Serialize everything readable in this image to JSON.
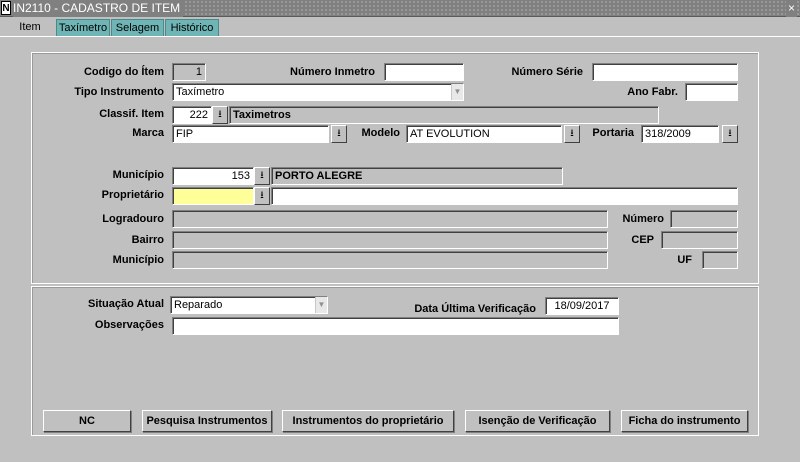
{
  "window": {
    "icon_letter": "N",
    "title": "IN2110 - CADASTRO DE ITEM",
    "close": "×"
  },
  "tabs": [
    {
      "label": "Item",
      "active": true
    },
    {
      "label": "Taxímetro",
      "active": false
    },
    {
      "label": "Selagem",
      "active": false
    },
    {
      "label": "Histórico",
      "active": false
    }
  ],
  "form": {
    "codigo_item": {
      "label": "Codigo do Ítem",
      "value": "1"
    },
    "numero_inmetro": {
      "label": "Número Inmetro",
      "value": ""
    },
    "numero_serie": {
      "label": "Número Série",
      "value": ""
    },
    "tipo_instrumento": {
      "label": "Tipo Instrumento",
      "value": "Taxímetro"
    },
    "ano_fabr": {
      "label": "Ano Fabr.",
      "value": ""
    },
    "classif_item": {
      "label": "Classif. Item",
      "code": "222",
      "description": "Taximetros"
    },
    "marca": {
      "label": "Marca",
      "value": "FIP"
    },
    "modelo": {
      "label": "Modelo",
      "value": "AT EVOLUTION"
    },
    "portaria": {
      "label": "Portaria",
      "value": "318/2009"
    },
    "municipio": {
      "label": "Município",
      "code": "153",
      "description": "PORTO ALEGRE"
    },
    "proprietario": {
      "label": "Proprietário",
      "code": "",
      "name": ""
    },
    "logradouro": {
      "label": "Logradouro",
      "value": ""
    },
    "numero": {
      "label": "Número",
      "value": ""
    },
    "bairro": {
      "label": "Bairro",
      "value": ""
    },
    "cep": {
      "label": "CEP",
      "value": ""
    },
    "municipio2": {
      "label": "Município",
      "value": ""
    },
    "uf": {
      "label": "UF",
      "value": ""
    },
    "situacao_atual": {
      "label": "Situação Atual",
      "value": "Reparado"
    },
    "data_ultima_verificacao": {
      "label": "Data Última Verificação",
      "value": "18/09/2017"
    },
    "observacoes": {
      "label": "Observações",
      "value": ""
    }
  },
  "buttons": {
    "nc": "NC",
    "pesquisa": "Pesquisa Instrumentos",
    "instrumentos_proprietario": "Instrumentos do proprietário",
    "isencao": "Isenção de Verificação",
    "ficha": "Ficha do instrumento"
  },
  "icons": {
    "lov": "download-arrow-icon",
    "dropdown": "chevron-down-icon"
  },
  "colors": {
    "tab_inactive": "#6fb5b5",
    "required_field": "#ffff99",
    "background": "#c0c0c0"
  }
}
